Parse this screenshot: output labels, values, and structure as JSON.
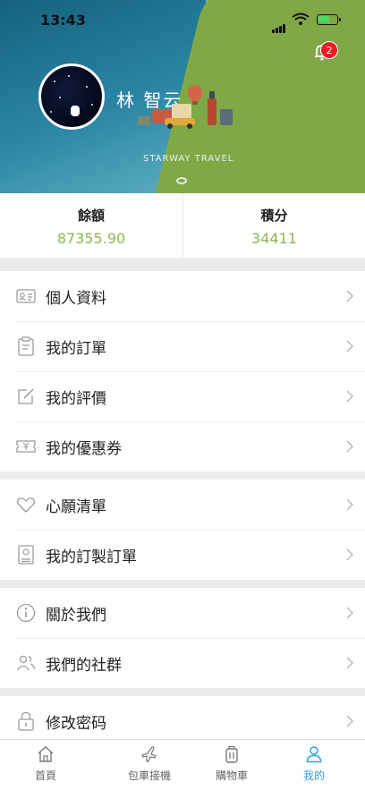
{
  "status_bar": {
    "time": "13:43"
  },
  "header": {
    "username": "林 智云",
    "notification_count": "2",
    "brand_text": "STARWAY TRAVEL",
    "colors": {
      "teal": "#2a86a4",
      "green": "#80a946"
    }
  },
  "stats": {
    "balance_label": "餘額",
    "balance_value": "87355.90",
    "points_label": "積分",
    "points_value": "34411",
    "value_color": "#8cb951"
  },
  "menu_groups": [
    {
      "items": [
        {
          "label": "個人資料",
          "icon": "id-card-icon"
        },
        {
          "label": "我的訂單",
          "icon": "clipboard-icon"
        },
        {
          "label": "我的評價",
          "icon": "edit-icon"
        },
        {
          "label": "我的優惠券",
          "icon": "coupon-icon"
        }
      ]
    },
    {
      "items": [
        {
          "label": "心願清單",
          "icon": "heart-icon"
        },
        {
          "label": "我的訂製訂單",
          "icon": "custom-order-icon"
        }
      ]
    },
    {
      "items": [
        {
          "label": "關於我們",
          "icon": "info-icon"
        },
        {
          "label": "我們的社群",
          "icon": "community-icon"
        }
      ]
    },
    {
      "items": [
        {
          "label": "修改密码",
          "icon": "lock-icon"
        }
      ]
    }
  ],
  "tabbar": {
    "active": "我的",
    "active_color": "#2aa3d6",
    "tabs": [
      {
        "label": "首頁",
        "icon": "home-icon"
      },
      {
        "label": "包車接機",
        "icon": "plane-icon"
      },
      {
        "label": "購物車",
        "icon": "luggage-icon"
      },
      {
        "label": "我的",
        "icon": "profile-icon"
      }
    ]
  }
}
